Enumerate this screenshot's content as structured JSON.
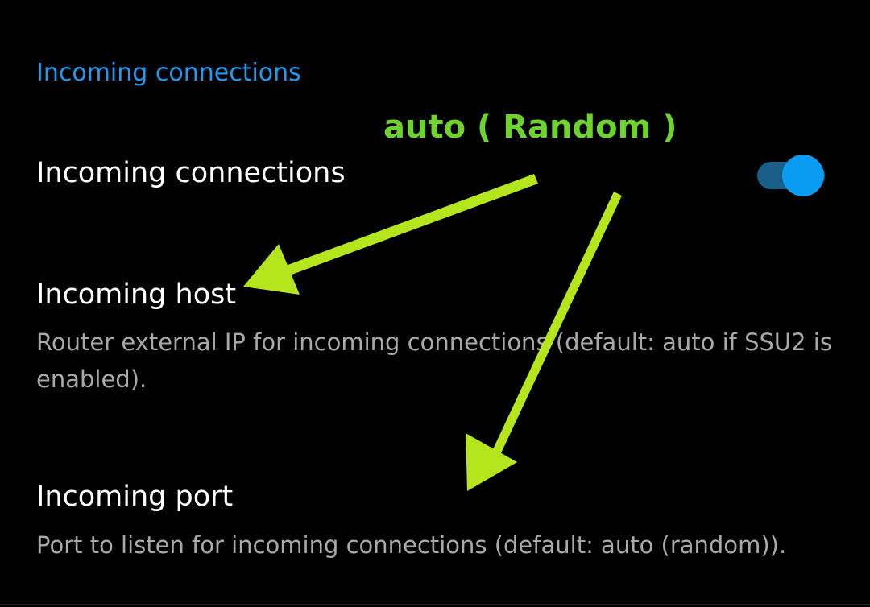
{
  "section": {
    "header": "Incoming connections"
  },
  "preferences": {
    "incoming_connections": {
      "title": "Incoming connections",
      "enabled": true
    },
    "incoming_host": {
      "title": "Incoming host",
      "summary": "Router external IP for incoming connections (default: auto if SSU2 is enabled)."
    },
    "incoming_port": {
      "title": "Incoming port",
      "summary": "Port to listen for incoming connections (default: auto (random))."
    }
  },
  "annotation": {
    "text": "auto ( Random )",
    "color": "#6fd32e",
    "arrow_color": "#b5e61d"
  },
  "colors": {
    "accent": "#1e9bf0",
    "switch_thumb": "#0a9bf2",
    "switch_track": "#1a5f88",
    "title": "#ffffff",
    "summary": "#a9a9a9",
    "background": "#000000"
  }
}
